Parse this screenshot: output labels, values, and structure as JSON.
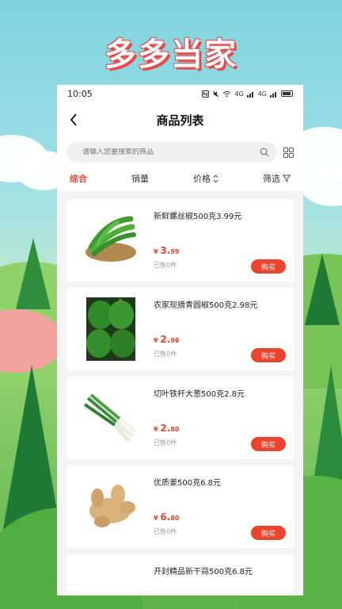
{
  "banner": {
    "app_name": "多多当家"
  },
  "status_bar": {
    "time": "10:05",
    "signal_label": "4G"
  },
  "nav": {
    "title": "商品列表"
  },
  "search": {
    "placeholder": "请输入您要搜索的商品"
  },
  "sort_tabs": [
    {
      "label": "综合",
      "active": true
    },
    {
      "label": "销量",
      "active": false
    },
    {
      "label": "价格",
      "active": false
    },
    {
      "label": "筛选",
      "active": false
    }
  ],
  "products": [
    {
      "name": "新鲜螺丝椒500克3.99元",
      "currency": "¥",
      "price_int": "3.",
      "price_dec": "99",
      "sold": "已售0件",
      "buy": "购买",
      "image": "green-chili"
    },
    {
      "name": "农家现摘青圆椒500克2.98元",
      "currency": "¥",
      "price_int": "2.",
      "price_dec": "98",
      "sold": "已售0件",
      "buy": "购买",
      "image": "green-bell-pepper"
    },
    {
      "name": "切叶铁杆大葱500克2.8元",
      "currency": "¥",
      "price_int": "2.",
      "price_dec": "80",
      "sold": "已售0件",
      "buy": "购买",
      "image": "green-onion"
    },
    {
      "name": "优质姜500克6.8元",
      "currency": "¥",
      "price_int": "6.",
      "price_dec": "80",
      "sold": "已售0件",
      "buy": "购买",
      "image": "ginger"
    },
    {
      "name": "开封精品新干蒜500克6.8元",
      "image": "garlic"
    }
  ],
  "colors": {
    "accent": "#e8442e",
    "background": "#f4f4f4"
  }
}
